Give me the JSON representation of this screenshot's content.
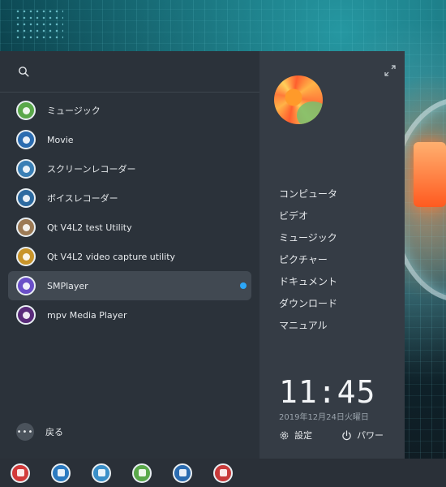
{
  "colors": {
    "panel_left": "#2b323a",
    "panel_right": "#353c45",
    "active_item": "#414952",
    "new_dot": "#2ca7f8",
    "text": "#e6e9ec"
  },
  "search": {
    "icon": "search-icon"
  },
  "apps": [
    {
      "label": "ミュージック",
      "icon": "music-icon",
      "color": "#5aa84a"
    },
    {
      "label": "Movie",
      "icon": "movie-icon",
      "color": "#2b6cb0"
    },
    {
      "label": "スクリーンレコーダー",
      "icon": "screen-recorder-icon",
      "color": "#3a7fb5"
    },
    {
      "label": "ボイスレコーダー",
      "icon": "voice-recorder-icon",
      "color": "#2d6aa0"
    },
    {
      "label": "Qt V4L2 test Utility",
      "icon": "qt-v4l2-icon",
      "color": "#9c7a55"
    },
    {
      "label": "Qt V4L2 video capture utility",
      "icon": "video-capture-icon",
      "color": "#c8942a"
    },
    {
      "label": "SMPlayer",
      "icon": "smplayer-icon",
      "color": "#6a4fc8",
      "active": true,
      "new": true
    },
    {
      "label": "mpv Media Player",
      "icon": "mpv-icon",
      "color": "#5a2b7a"
    }
  ],
  "back_label": "戻る",
  "places": [
    "コンピュータ",
    "ビデオ",
    "ミュージック",
    "ピクチャー",
    "ドキュメント",
    "ダウンロード",
    "マニュアル"
  ],
  "clock": {
    "time": "11:45",
    "date": "2019年12月24日火曜日"
  },
  "actions": {
    "settings": "設定",
    "power": "パワー"
  },
  "taskbar": [
    {
      "icon": "launcher-rocket-icon",
      "color": "#d23a3a"
    },
    {
      "icon": "multitasking-view-icon",
      "color": "#2b7ac0"
    },
    {
      "icon": "file-manager-icon",
      "color": "#3a8fc8"
    },
    {
      "icon": "music-icon",
      "color": "#5aa84a"
    },
    {
      "icon": "movie-icon",
      "color": "#2b6cb0"
    },
    {
      "icon": "screen-recorder-icon",
      "color": "#c83a3a"
    }
  ]
}
